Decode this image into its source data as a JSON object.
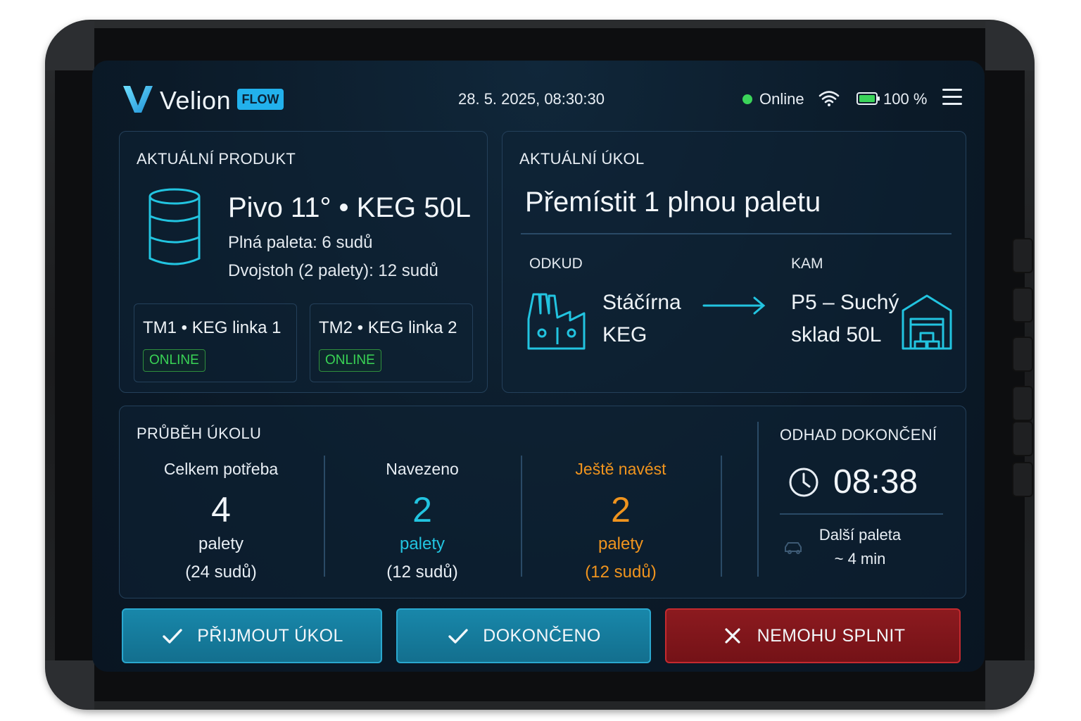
{
  "header": {
    "brand": "Velion",
    "badge": "FLOW",
    "datetime": "28. 5. 2025, 08:30:30",
    "status": "Online",
    "battery": "100 %"
  },
  "product": {
    "title": "AKTUÁLNÍ PRODUKT",
    "name": "Pivo 11° • KEG 50L",
    "pallet": "Plná paleta: 6 sudů",
    "double": "Dvojstoh (2 palety): 12 sudů",
    "machines": [
      {
        "name": "TM1 • KEG linka 1",
        "status": "ONLINE"
      },
      {
        "name": "TM2 • KEG linka 2",
        "status": "ONLINE"
      }
    ]
  },
  "task": {
    "title": "AKTUÁLNÍ ÚKOL",
    "headline": "Přemístit 1 plnou paletu",
    "from_label": "ODKUD",
    "from_line1": "Stáčírna",
    "from_line2": "KEG",
    "to_label": "KAM",
    "to_line1": "P5 – Suchý",
    "to_line2": "sklad 50L"
  },
  "progress": {
    "title": "PRŮBĚH ÚKOLU",
    "stats": [
      {
        "label": "Celkem potřeba",
        "value": "4",
        "unit": "palety",
        "kegs": "(24 sudů)"
      },
      {
        "label": "Navezeno",
        "value": "2",
        "unit": "palety",
        "kegs": "(12 sudů)"
      },
      {
        "label": "Ještě navést",
        "value": "2",
        "unit": "palety",
        "kegs": "(12 sudů)"
      }
    ],
    "estimate_title": "ODHAD DOKONČENÍ",
    "estimate_time": "08:38",
    "next_label": "Další paleta",
    "next_value": "~ 4 min"
  },
  "actions": {
    "accept": "PŘIJMOUT ÚKOL",
    "done": "DOKONČENO",
    "fail": "NEMOHU SPLNIT"
  },
  "colors": {
    "accent_cyan": "#22c4e0",
    "accent_orange": "#f0941e",
    "online_green": "#39d455",
    "danger_red": "#8c1a1f"
  }
}
